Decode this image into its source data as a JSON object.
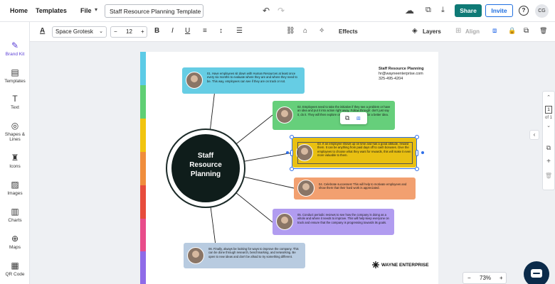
{
  "topbar": {
    "home": "Home",
    "templates": "Templates",
    "file": "File",
    "file_chevron": "▾",
    "doc_title": "Staff Resource Planning Template",
    "undo_icon": "↶",
    "redo_icon": "↷",
    "cloud_icon": "☁",
    "present_icon": "⧉",
    "download_icon": "⤓",
    "share": "Share",
    "invite": "Invite",
    "help": "?",
    "avatar_initials": "CG"
  },
  "sidebar": [
    {
      "label": "Brand Kit",
      "icon": "✎"
    },
    {
      "label": "Templates",
      "icon": "▤"
    },
    {
      "label": "Text",
      "icon": "T"
    },
    {
      "label": "Shapes &",
      "label2": "Lines",
      "icon": "◎"
    },
    {
      "label": "Icons",
      "icon": "♜"
    },
    {
      "label": "Images",
      "icon": "▨"
    },
    {
      "label": "Charts",
      "icon": "▥"
    },
    {
      "label": "Maps",
      "icon": "⊕"
    },
    {
      "label": "QR Code",
      "icon": "▦"
    }
  ],
  "format": {
    "text_color_icon": "A",
    "font": "Space Grotesk",
    "font_chevron": "⌄",
    "size": "12",
    "minus": "−",
    "plus": "+",
    "bold": "B",
    "italic": "I",
    "underline": "U",
    "align_icon": "≡",
    "spacing_icon": "↕",
    "list_icon": "☰",
    "link_icon": "⛓",
    "tag_icon": "⌂",
    "magic_icon": "✧",
    "effects": "Effects",
    "layers_icon": "◈",
    "layers": "Layers",
    "align_label_icon": "⊞",
    "align": "Align",
    "group_icon": "⧈",
    "lock_icon": "🔒",
    "copy_icon": "⧉",
    "delete_icon": "🗑"
  },
  "page": {
    "stripe_colors": [
      "#5ccbe6",
      "#5fcf74",
      "#f1c40f",
      "#f08d3c",
      "#e74c3c",
      "#e84c8a",
      "#8e6be8"
    ],
    "contact_name": "Staff Resource Planning",
    "contact_email": "hr@wayneenterprise.com",
    "contact_phone": "325-495-4204",
    "hub_line1": "Staff",
    "hub_line2": "Resource",
    "hub_line3": "Planning",
    "brand": "WAYNE ENTERPRISE",
    "cards": [
      {
        "color": "#66cde4",
        "text": "01. Have employees sit down with Human Resources at least once every six months to evaluate where they are and where they need to be. This way, employees can see if they are on track or not."
      },
      {
        "color": "#66cf7b",
        "text": "02. Employees need to take the initiative if they see a problem or have an idea and put it into action right away. Follow through: don't just say it, do it. They will then explore or execute their ideas for a better idea."
      },
      {
        "color": "#e9c012",
        "text": "03. If an employee shows up on time and has a good attitude, reward them. It can be anything from paid days off to cash bonuses. Give the employees to choose what they want for rewards, this will make it even more valuable to them."
      },
      {
        "color": "#f2a070",
        "text": "04. Celebrate successes! This will help to motivate employees and show them that their hard work is appreciated."
      },
      {
        "color": "#b19cf0",
        "text": "05. Conduct periodic reviews to see how the company is doing as a whole and where it needs to improve. This will help keep everyone on track and ensure that the company is progressing towards its goals."
      },
      {
        "color": "#b8cbe0",
        "text": "06. Finally, always be looking for ways to improve the company. This can be done through research, benchmarking, and networking. Be open to new ideas and don't be afraid to try something different."
      }
    ]
  },
  "float_tools": {
    "duplicate_icon": "⧉",
    "group_icon": "⧈"
  },
  "rpanel": {
    "up_icon": "⌃",
    "page_num": "1",
    "of": "of 1",
    "down_icon": "⌄",
    "copy_icon": "⧉",
    "add_icon": "+",
    "delete_icon": "🗑",
    "collapse_icon": "‹"
  },
  "zoom": {
    "minus": "−",
    "value": "73%",
    "plus": "+"
  }
}
